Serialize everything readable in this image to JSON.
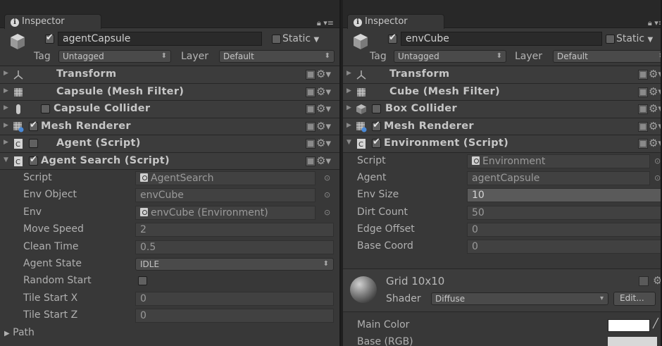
{
  "left": {
    "tab": {
      "title": "Inspector"
    },
    "object": {
      "name": "agentCapsule",
      "active": true,
      "static_label": "Static"
    },
    "tag": {
      "label": "Tag",
      "value": "Untagged"
    },
    "layer": {
      "label": "Layer",
      "value": "Default"
    },
    "components": [
      {
        "title": "Transform",
        "icon": "transform-icon",
        "has_checkbox": false,
        "expanded": false
      },
      {
        "title": "Capsule (Mesh Filter)",
        "icon": "mesh-filter-icon",
        "has_checkbox": false,
        "expanded": false
      },
      {
        "title": "Capsule Collider",
        "icon": "capsule-collider-icon",
        "has_checkbox": true,
        "checked": false,
        "expanded": false
      },
      {
        "title": "Mesh Renderer",
        "icon": "mesh-renderer-icon",
        "has_checkbox": true,
        "checked": true,
        "expanded": false
      },
      {
        "title": "Agent (Script)",
        "icon": "script-icon",
        "has_checkbox": true,
        "checked": false,
        "expanded": false
      },
      {
        "title": "Agent Search (Script)",
        "icon": "script-icon",
        "has_checkbox": true,
        "checked": true,
        "expanded": true
      }
    ],
    "props": {
      "script": {
        "label": "Script",
        "value": "AgentSearch"
      },
      "env_object": {
        "label": "Env Object",
        "value": "envCube"
      },
      "env": {
        "label": "Env",
        "value": "envCube (Environment)"
      },
      "move_speed": {
        "label": "Move Speed",
        "value": "2"
      },
      "clean_time": {
        "label": "Clean Time",
        "value": "0.5"
      },
      "agent_state": {
        "label": "Agent State",
        "value": "IDLE"
      },
      "random_start": {
        "label": "Random Start",
        "checked": false
      },
      "tile_start_x": {
        "label": "Tile Start X",
        "value": "0"
      },
      "tile_start_z": {
        "label": "Tile Start Z",
        "value": "0"
      },
      "path": {
        "label": "Path"
      }
    }
  },
  "right": {
    "tab": {
      "title": "Inspector"
    },
    "object": {
      "name": "envCube",
      "active": true,
      "static_label": "Static"
    },
    "tag": {
      "label": "Tag",
      "value": "Untagged"
    },
    "layer": {
      "label": "Layer",
      "value": "Default"
    },
    "components": [
      {
        "title": "Transform",
        "icon": "transform-icon",
        "has_checkbox": false,
        "expanded": false
      },
      {
        "title": "Cube (Mesh Filter)",
        "icon": "mesh-filter-icon",
        "has_checkbox": false,
        "expanded": false
      },
      {
        "title": "Box Collider",
        "icon": "box-collider-icon",
        "has_checkbox": true,
        "checked": false,
        "expanded": false
      },
      {
        "title": "Mesh Renderer",
        "icon": "mesh-renderer-icon",
        "has_checkbox": true,
        "checked": true,
        "expanded": false
      },
      {
        "title": "Environment (Script)",
        "icon": "script-icon",
        "has_checkbox": true,
        "checked": true,
        "expanded": true
      }
    ],
    "props": {
      "script": {
        "label": "Script",
        "value": "Environment"
      },
      "agent": {
        "label": "Agent",
        "value": "agentCapsule"
      },
      "env_size": {
        "label": "Env Size",
        "value": "10"
      },
      "dirt_count": {
        "label": "Dirt Count",
        "value": "50"
      },
      "edge_offset": {
        "label": "Edge Offset",
        "value": "0"
      },
      "base_coord": {
        "label": "Base Coord",
        "value": "0"
      }
    },
    "material": {
      "name": "Grid 10x10",
      "shader_label": "Shader",
      "shader_value": "Diffuse",
      "edit_label": "Edit...",
      "main_color_label": "Main Color",
      "main_color": "#ffffff",
      "base_label": "Base (RGB)"
    }
  },
  "colors": {
    "panel_bg": "#383838",
    "tab_bg": "#282828",
    "component_bg": "#3c3c3c",
    "field_bg": "#414141",
    "text": "#b4b4b4"
  }
}
